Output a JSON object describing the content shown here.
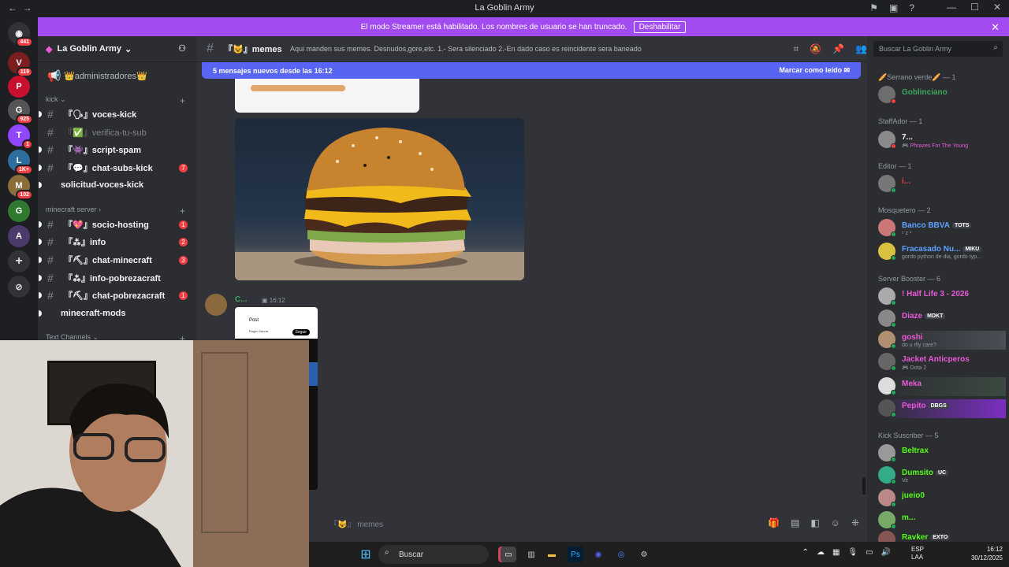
{
  "titlebar": {
    "title": "La Goblin Army"
  },
  "server_rail": {
    "badges": [
      "441",
      "119",
      "925",
      "1",
      "1K+",
      "102"
    ]
  },
  "banner": {
    "text": "El modo Streamer está habilitado. Los nombres de usuario se han truncado.",
    "button": "Deshabilitar"
  },
  "server": {
    "name": "La Goblin Army"
  },
  "channels": {
    "top": "👑administradores👑",
    "cat_kick": "kick",
    "cat_mc": "minecraft server",
    "cat_text": "Text Channels",
    "items": [
      {
        "name": "『🗣』voces-kick",
        "count": ""
      },
      {
        "name": "『✅』verifica-tu-sub",
        "count": ""
      },
      {
        "name": "『👾』script-spam",
        "count": ""
      },
      {
        "name": "『💬』chat-subs-kick",
        "count": "7"
      },
      {
        "name": "solicitud-voces-kick",
        "count": ""
      },
      {
        "name": "『💖』socio-hosting",
        "count": "1"
      },
      {
        "name": "『⁂』info",
        "count": "2"
      },
      {
        "name": "『⛏』chat-minecraft",
        "count": "3"
      },
      {
        "name": "『⁂』info-pobrezacraft",
        "count": ""
      },
      {
        "name": "『⛏』chat-pobrezacraft",
        "count": "1"
      },
      {
        "name": "minecraft-mods",
        "count": ""
      }
    ]
  },
  "chat": {
    "channel": "『😺』memes",
    "topic": "Aqui manden sus memes. Desnudos,gore,etc. 1.- Sera silenciado 2.-En dado caso es reincidente sera baneado",
    "new_messages": "5 mensajes nuevos desde las 16:12",
    "mark_read": "Marcar como leído",
    "author": "C...",
    "time": "16:12",
    "phone_title": "Post",
    "phone_name": "Roger García",
    "phone_button": "Seguir",
    "input_placeholder": "『😺』 memes"
  },
  "members": {
    "search_placeholder": "Buscar La Goblin Army",
    "groups": [
      {
        "title": "🥖Serrano verde🥖 — 1",
        "members": [
          {
            "name": "Goblinciano",
            "sub": "",
            "tag": "",
            "color": "#3ba55c"
          }
        ]
      },
      {
        "title": "StaffAdor — 1",
        "members": [
          {
            "name": "7...",
            "sub": "🎮 Phrazes For The Young",
            "tag": "",
            "color": "#f2f3f5"
          }
        ]
      },
      {
        "title": "Editor — 1",
        "members": [
          {
            "name": "i...",
            "sub": "",
            "tag": "",
            "color": "#f23f43"
          }
        ]
      },
      {
        "title": "Mosquetero — 2",
        "members": [
          {
            "name": "Banco BBVA",
            "sub": "ᶻ z ¹",
            "tag": "TOTS",
            "color": "#5ea2ff"
          },
          {
            "name": "Fracasado Nu...",
            "sub": "gordo python de dia, gordo typ...",
            "tag": "MIKU",
            "color": "#5ea2ff"
          }
        ]
      },
      {
        "title": "Server Booster — 6",
        "members": [
          {
            "name": "! Half Life 3 - 2026",
            "sub": "",
            "tag": "",
            "color": "#eb59d8"
          },
          {
            "name": "Diaze",
            "sub": "",
            "tag": "MDKT",
            "color": "#eb59d8"
          },
          {
            "name": "goshi",
            "sub": "do u rlly care?",
            "tag": "",
            "color": "#eb59d8"
          },
          {
            "name": "Jacket Anticperos",
            "sub": "🎮 Dota 2",
            "tag": "",
            "color": "#eb59d8"
          },
          {
            "name": "Meka",
            "sub": "",
            "tag": "",
            "color": "#eb59d8"
          },
          {
            "name": "Pepito",
            "sub": "",
            "tag": "DBGS",
            "color": "#eb59d8"
          }
        ]
      },
      {
        "title": "Kick Suscriber — 5",
        "members": [
          {
            "name": "Beltrax",
            "sub": "",
            "tag": "",
            "color": "#53fc18"
          },
          {
            "name": "Dumsito",
            "sub": "Ve",
            "tag": "UC",
            "color": "#53fc18"
          },
          {
            "name": "jueio0",
            "sub": "",
            "tag": "",
            "color": "#53fc18"
          },
          {
            "name": "m...",
            "sub": "",
            "tag": "",
            "color": "#53fc18"
          },
          {
            "name": "Ravker",
            "sub": "",
            "tag": "EXTO",
            "color": "#53fc18"
          }
        ]
      }
    ]
  },
  "taskbar": {
    "search": "Buscar",
    "lang": "ESP",
    "lang2": "LAA",
    "time": "16:12",
    "date": "30/12/2025"
  },
  "colors": {
    "accent": "#5865f2",
    "banner": "#a14bf0",
    "badge": "#f23f43"
  }
}
